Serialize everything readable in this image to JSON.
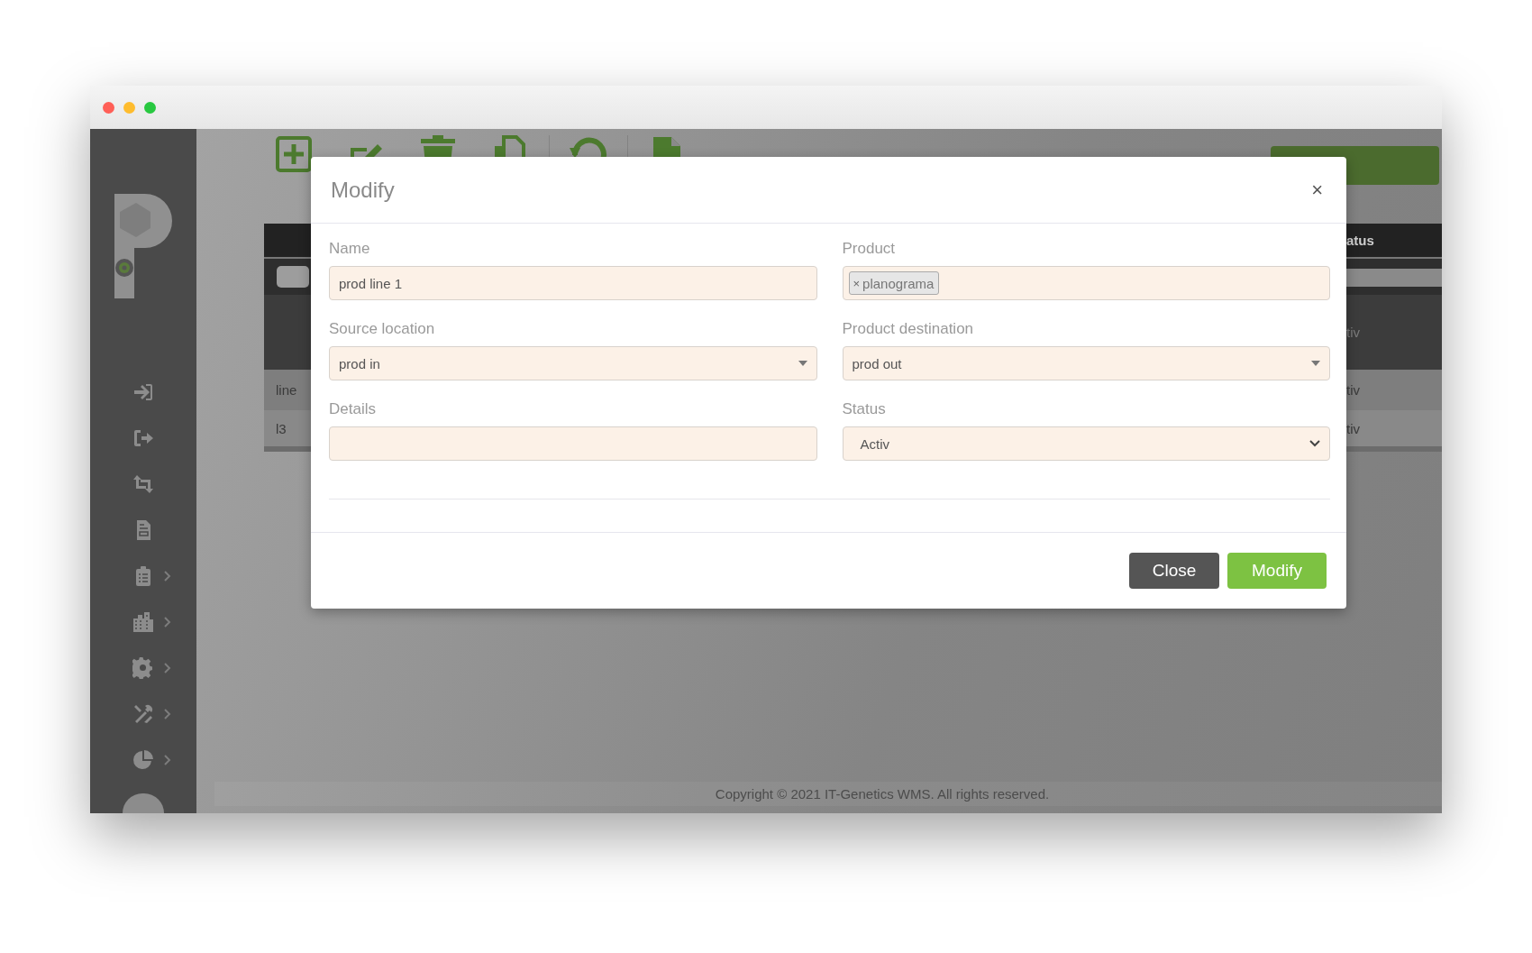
{
  "window": {
    "controls": [
      {
        "color": "#ff5f57"
      },
      {
        "color": "#febc2e"
      },
      {
        "color": "#28c840"
      }
    ]
  },
  "sidebar": {
    "items": [
      {
        "kind": "sign-in",
        "expandable": false
      },
      {
        "kind": "sign-out",
        "expandable": false
      },
      {
        "kind": "transfer",
        "expandable": false
      },
      {
        "kind": "document",
        "expandable": false
      },
      {
        "kind": "clipboard",
        "expandable": true
      },
      {
        "kind": "building",
        "expandable": true
      },
      {
        "kind": "gear",
        "expandable": true
      },
      {
        "kind": "tools",
        "expandable": true
      },
      {
        "kind": "pie",
        "expandable": true
      }
    ]
  },
  "toolbar": {
    "groups": [
      {
        "items": [
          {
            "kind": "add"
          },
          {
            "kind": "edit"
          },
          {
            "kind": "delete"
          },
          {
            "kind": "copy"
          }
        ]
      },
      {
        "items": [
          {
            "kind": "undo"
          }
        ]
      },
      {
        "items": [
          {
            "kind": "file"
          }
        ]
      }
    ]
  },
  "table": {
    "header_end": "atus",
    "rows": [
      {
        "kind": "dark",
        "column_end": "tiv"
      },
      {
        "kind": "light",
        "column_1": "line",
        "column_end": "tiv"
      },
      {
        "kind": "shaded",
        "column_1": "l3",
        "column_end": "tiv"
      }
    ]
  },
  "footer": "Copyright © 2021 IT-Genetics WMS. All rights reserved.",
  "modal": {
    "title": "Modify",
    "close": "×",
    "fields": [
      {
        "kind": "text",
        "label": "Name",
        "value": "prod line 1"
      },
      {
        "kind": "tags",
        "label": "Product",
        "tags": [
          {
            "remove": "×",
            "text": "planograma"
          }
        ]
      },
      {
        "kind": "combo",
        "label": "Source location",
        "value": "prod in"
      },
      {
        "kind": "combo",
        "label": "Product destination",
        "value": "prod out"
      },
      {
        "kind": "text",
        "label": "Details"
      },
      {
        "kind": "select",
        "label": "Status",
        "value": "Activ"
      }
    ],
    "buttons": [
      {
        "kind": "secondary",
        "label": "Close"
      },
      {
        "kind": "primary",
        "label": "Modify"
      }
    ]
  }
}
